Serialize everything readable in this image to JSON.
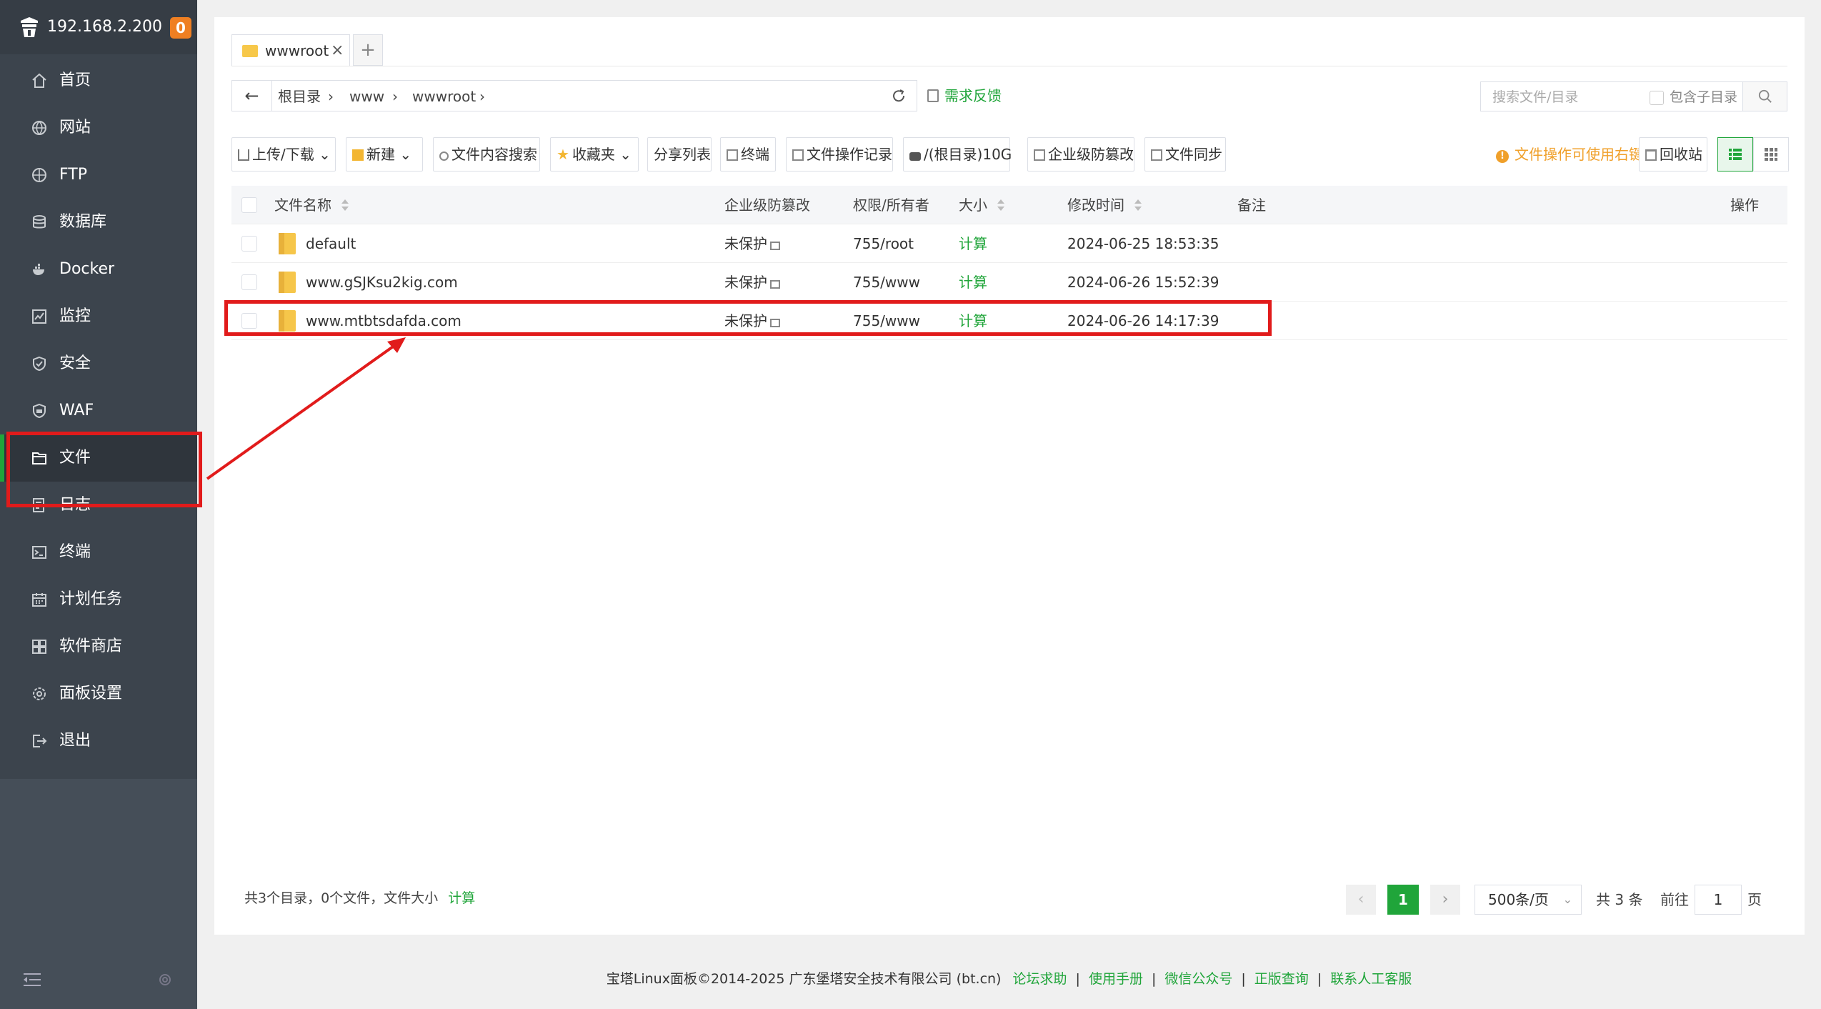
{
  "sidebar": {
    "ip": "192.168.2.200",
    "badge": "0",
    "items": [
      {
        "label": "首页",
        "icon": "home-icon"
      },
      {
        "label": "网站",
        "icon": "globe-icon"
      },
      {
        "label": "FTP",
        "icon": "ftp-icon"
      },
      {
        "label": "数据库",
        "icon": "database-icon"
      },
      {
        "label": "Docker",
        "icon": "docker-icon"
      },
      {
        "label": "监控",
        "icon": "monitor-icon"
      },
      {
        "label": "安全",
        "icon": "shield-icon"
      },
      {
        "label": "WAF",
        "icon": "waf-icon"
      },
      {
        "label": "文件",
        "icon": "folder-icon"
      },
      {
        "label": "日志",
        "icon": "log-icon"
      },
      {
        "label": "终端",
        "icon": "terminal-icon"
      },
      {
        "label": "计划任务",
        "icon": "calendar-icon"
      },
      {
        "label": "软件商店",
        "icon": "apps-icon"
      },
      {
        "label": "面板设置",
        "icon": "gear-icon"
      },
      {
        "label": "退出",
        "icon": "logout-icon"
      }
    ],
    "active_index": 8
  },
  "tabs": [
    {
      "label": "wwwroot"
    }
  ],
  "breadcrumb": [
    "根目录",
    "www",
    "wwwroot"
  ],
  "feedback_label": "需求反馈",
  "search": {
    "placeholder": "搜索文件/目录",
    "include_sub_label": "包含子目录"
  },
  "toolbar": {
    "upload": "上传/下载",
    "new": "新建",
    "content_search": "文件内容搜索",
    "favorites": "收藏夹",
    "share_list": "分享列表",
    "terminal": "终端",
    "op_log": "文件操作记录",
    "disk": "/(根目录)10G",
    "tamper": "企业级防篡改",
    "sync": "文件同步",
    "tip": "文件操作可使用右键",
    "recycle": "回收站"
  },
  "table": {
    "headers": {
      "name": "文件名称",
      "tamper": "企业级防篡改",
      "perm": "权限/所有者",
      "size": "大小",
      "mtime": "修改时间",
      "note": "备注",
      "ops": "操作"
    },
    "rows": [
      {
        "name": "default",
        "tamper": "未保护",
        "perm": "755/root",
        "size": "计算",
        "mtime": "2024-06-25 18:53:35"
      },
      {
        "name": "www.gSJKsu2kig.com",
        "tamper": "未保护",
        "perm": "755/www",
        "size": "计算",
        "mtime": "2024-06-26 15:52:39"
      },
      {
        "name": "www.mtbtsdafda.com",
        "tamper": "未保护",
        "perm": "755/www",
        "size": "计算",
        "mtime": "2024-06-26 14:17:39"
      }
    ]
  },
  "footer_stats": {
    "text": "共3个目录，0个文件，文件大小",
    "calc": "计算"
  },
  "pagination": {
    "current": "1",
    "page_size": "500条/页",
    "total": "共 3 条",
    "goto_label": "前往",
    "goto_value": "1",
    "page_suffix": "页"
  },
  "page_footer": {
    "copyright": "宝塔Linux面板©2014-2025 广东堡塔安全技术有限公司 (bt.cn)",
    "links": [
      "论坛求助",
      "使用手册",
      "微信公众号",
      "正版查询",
      "联系人工客服"
    ]
  },
  "colors": {
    "accent": "#20a53a",
    "sidebar": "#3c444d",
    "highlight": "#e11b1b",
    "badge": "#ef7f22"
  }
}
